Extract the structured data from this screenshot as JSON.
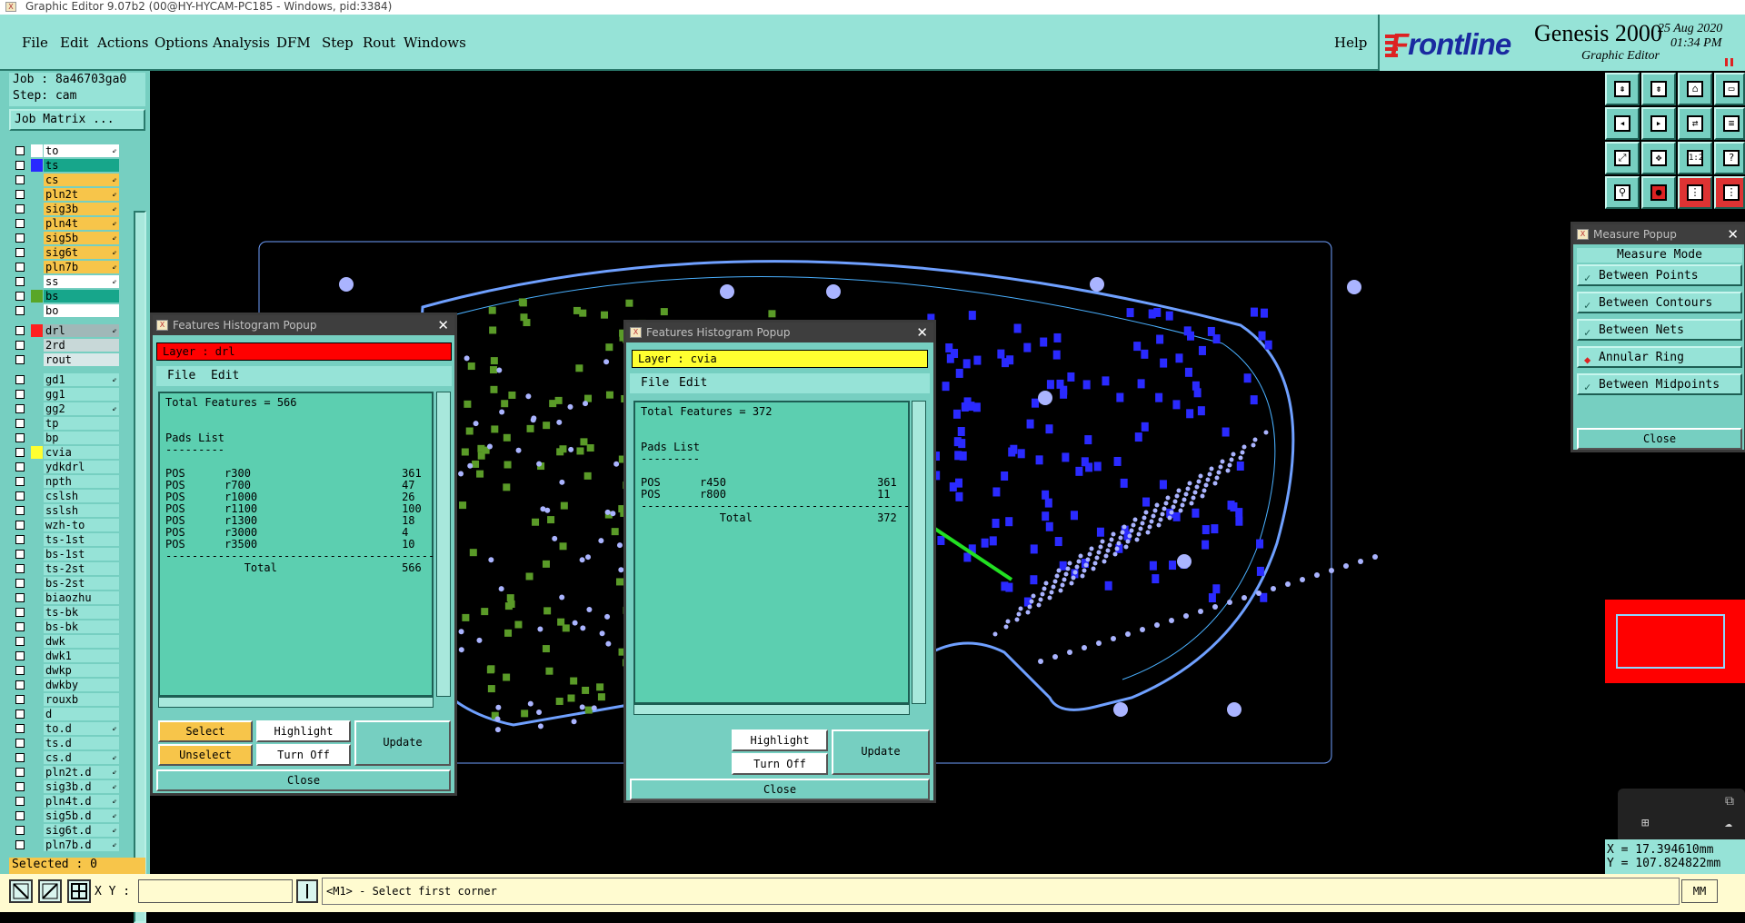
{
  "window": {
    "title": "Graphic Editor 9.07b2 (00@HY-HYCAM-PC185 - Windows, pid:3384)"
  },
  "menu": {
    "items": [
      "File",
      "Edit",
      "Actions",
      "Options",
      "Analysis",
      "DFM",
      "Step",
      "Rout",
      "Windows"
    ],
    "help": "Help"
  },
  "brand": {
    "logo_a": "F",
    "logo_b": "rontline",
    "product": "Genesis 2000",
    "subtitle": "Graphic Editor",
    "date": "25 Aug 2020",
    "time": "01:34 PM"
  },
  "job": {
    "job": "Job : 8a46703ga0",
    "step": "Step: cam",
    "matrix": "Job Matrix ..."
  },
  "layers": [
    {
      "name": "to",
      "color": "#ffffff",
      "box": "#ffffff",
      "arrow": "⇙"
    },
    {
      "name": "ts",
      "color": "#2828ff",
      "box": "#17a68b",
      "arrow": ""
    },
    {
      "name": "cs",
      "color": "#76cfc1",
      "box": "#f7c54a",
      "arrow": "⇙"
    },
    {
      "name": "pln2t",
      "color": "#76cfc1",
      "box": "#f7c54a",
      "arrow": "⇙"
    },
    {
      "name": "sig3b",
      "color": "#76cfc1",
      "box": "#f7c54a",
      "arrow": "⇙"
    },
    {
      "name": "pln4t",
      "color": "#76cfc1",
      "box": "#f7c54a",
      "arrow": "⇙"
    },
    {
      "name": "sig5b",
      "color": "#76cfc1",
      "box": "#f7c54a",
      "arrow": "⇙"
    },
    {
      "name": "sig6t",
      "color": "#76cfc1",
      "box": "#f7c54a",
      "arrow": "⇙"
    },
    {
      "name": "pln7b",
      "color": "#76cfc1",
      "box": "#f7c54a",
      "arrow": "⇙"
    },
    {
      "name": "ss",
      "color": "#76cfc1",
      "box": "#ffffff",
      "arrow": "⇙"
    },
    {
      "name": "bs",
      "color": "#59a628",
      "box": "#17a68b",
      "arrow": ""
    },
    {
      "name": "bo",
      "color": "#76cfc1",
      "box": "#ffffff",
      "arrow": ""
    },
    {
      "name": "drl",
      "color": "#ff2020",
      "box": "#a0b8b8",
      "arrow": "⇙"
    },
    {
      "name": "2rd",
      "color": "#76cfc1",
      "box": "#c8d8d8",
      "arrow": ""
    },
    {
      "name": "rout",
      "color": "#76cfc1",
      "box": "#d8e8e8",
      "arrow": ""
    },
    {
      "name": "gd1",
      "color": "#76cfc1",
      "box": "#96e3d7",
      "arrow": "⇙"
    },
    {
      "name": "gg1",
      "color": "#76cfc1",
      "box": "#96e3d7",
      "arrow": ""
    },
    {
      "name": "gg2",
      "color": "#76cfc1",
      "box": "#96e3d7",
      "arrow": "⇙"
    },
    {
      "name": "tp",
      "color": "#76cfc1",
      "box": "#96e3d7",
      "arrow": ""
    },
    {
      "name": "bp",
      "color": "#76cfc1",
      "box": "#96e3d7",
      "arrow": ""
    },
    {
      "name": "cvia",
      "color": "#ffff30",
      "box": "#96e3d7",
      "arrow": ""
    },
    {
      "name": "ydkdrl",
      "color": "#76cfc1",
      "box": "#96e3d7",
      "arrow": ""
    },
    {
      "name": "npth",
      "color": "#76cfc1",
      "box": "#96e3d7",
      "arrow": ""
    },
    {
      "name": "cslsh",
      "color": "#76cfc1",
      "box": "#96e3d7",
      "arrow": ""
    },
    {
      "name": "sslsh",
      "color": "#76cfc1",
      "box": "#96e3d7",
      "arrow": ""
    },
    {
      "name": "wzh-to",
      "color": "#76cfc1",
      "box": "#96e3d7",
      "arrow": ""
    },
    {
      "name": "ts-1st",
      "color": "#76cfc1",
      "box": "#96e3d7",
      "arrow": ""
    },
    {
      "name": "bs-1st",
      "color": "#76cfc1",
      "box": "#96e3d7",
      "arrow": ""
    },
    {
      "name": "ts-2st",
      "color": "#76cfc1",
      "box": "#96e3d7",
      "arrow": ""
    },
    {
      "name": "bs-2st",
      "color": "#76cfc1",
      "box": "#96e3d7",
      "arrow": ""
    },
    {
      "name": "biaozhu",
      "color": "#76cfc1",
      "box": "#96e3d7",
      "arrow": ""
    },
    {
      "name": "ts-bk",
      "color": "#76cfc1",
      "box": "#96e3d7",
      "arrow": ""
    },
    {
      "name": "bs-bk",
      "color": "#76cfc1",
      "box": "#96e3d7",
      "arrow": ""
    },
    {
      "name": "dwk",
      "color": "#76cfc1",
      "box": "#96e3d7",
      "arrow": ""
    },
    {
      "name": "dwk1",
      "color": "#76cfc1",
      "box": "#96e3d7",
      "arrow": ""
    },
    {
      "name": "dwkp",
      "color": "#76cfc1",
      "box": "#96e3d7",
      "arrow": ""
    },
    {
      "name": "dwkby",
      "color": "#76cfc1",
      "box": "#96e3d7",
      "arrow": ""
    },
    {
      "name": "rouxb",
      "color": "#76cfc1",
      "box": "#96e3d7",
      "arrow": ""
    },
    {
      "name": "d",
      "color": "#76cfc1",
      "box": "#96e3d7",
      "arrow": ""
    },
    {
      "name": "to.d",
      "color": "#76cfc1",
      "box": "#96e3d7",
      "arrow": "⇙"
    },
    {
      "name": "ts.d",
      "color": "#76cfc1",
      "box": "#96e3d7",
      "arrow": ""
    },
    {
      "name": "cs.d",
      "color": "#76cfc1",
      "box": "#96e3d7",
      "arrow": "⇙"
    },
    {
      "name": "pln2t.d",
      "color": "#76cfc1",
      "box": "#96e3d7",
      "arrow": "⇙"
    },
    {
      "name": "sig3b.d",
      "color": "#76cfc1",
      "box": "#96e3d7",
      "arrow": "⇙"
    },
    {
      "name": "pln4t.d",
      "color": "#76cfc1",
      "box": "#96e3d7",
      "arrow": "⇙"
    },
    {
      "name": "sig5b.d",
      "color": "#76cfc1",
      "box": "#96e3d7",
      "arrow": "⇙"
    },
    {
      "name": "sig6t.d",
      "color": "#76cfc1",
      "box": "#96e3d7",
      "arrow": "⇙"
    },
    {
      "name": "pln7b.d",
      "color": "#76cfc1",
      "box": "#96e3d7",
      "arrow": "⇙"
    }
  ],
  "selected": "Selected : 0",
  "status": {
    "xy_label": "X Y :",
    "xy_value": "",
    "prompt": "<M1> - Select first corner",
    "units": "MM"
  },
  "coords": {
    "x": "X = 17.394610mm",
    "y": "Y = 107.824822mm"
  },
  "histo1": {
    "title": "Features Histogram Popup",
    "layer": "Layer : drl",
    "menu_file": "File",
    "menu_edit": "Edit",
    "text": "Total Features = 566\n\n\nPads List\n---------\n\nPOS      r300                       361\nPOS      r700                       47\nPOS      r1000                      26\nPOS      r1100                      100\nPOS      r1300                      18\nPOS      r3000                      4\nPOS      r3500                      10\n-----------------------------------------\n            Total                   566",
    "select": "Select",
    "unselect": "Unselect",
    "highlight": "Highlight",
    "turnoff": "Turn Off",
    "update": "Update",
    "close": "Close"
  },
  "histo2": {
    "title": "Features Histogram Popup",
    "layer": "Layer : cvia",
    "menu_file": "File",
    "menu_edit": "Edit",
    "text": "Total Features = 372\n\n\nPads List\n---------\n\nPOS      r450                       361\nPOS      r800                       11\n-----------------------------------------\n            Total                   372",
    "highlight": "Highlight",
    "turnoff": "Turn Off",
    "update": "Update",
    "close": "Close"
  },
  "measure": {
    "title": "Measure Popup",
    "header": "Measure Mode",
    "modes": [
      "Between Points",
      "Between Contours",
      "Between Nets",
      "Annular Ring",
      "Between Midpoints"
    ],
    "selected_index": 3,
    "close": "Close"
  },
  "colors": {
    "panel": "#76cfc1",
    "board_outline": "#6fa0ff",
    "pad_green": "#5a9b28",
    "pad_blue": "#2a2aff",
    "pad_light": "#aab4ff",
    "arrow": "#22e022"
  }
}
